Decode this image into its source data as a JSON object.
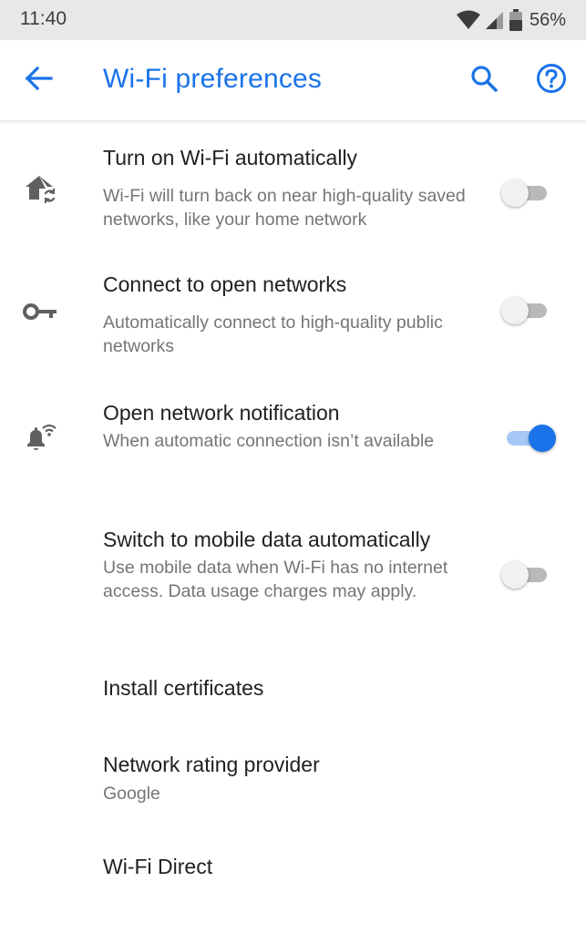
{
  "status_bar": {
    "time": "11:40",
    "battery_percent": "56%",
    "icons": [
      "wifi-signal-icon",
      "cell-signal-icon",
      "battery-icon"
    ]
  },
  "app_bar": {
    "title": "Wi-Fi preferences",
    "icons": [
      "back-arrow-icon",
      "search-icon",
      "help-icon"
    ],
    "accent_color": "#1a73e8"
  },
  "preferences": [
    {
      "title": "Turn on Wi-Fi automatically",
      "summary": "Wi-Fi will turn back on near high-quality saved networks, like your home network",
      "icon": "wifi-home-icon",
      "toggle_on": false
    },
    {
      "title": "Connect to open networks",
      "summary": "Automatically connect to high-quality public networks",
      "icon": "key-icon",
      "toggle_on": false
    },
    {
      "title": "Open network notification",
      "summary": "When automatic connection isn’t available",
      "icon": "wifi-notification-bell-icon",
      "toggle_on": true
    },
    {
      "title": "Switch to mobile data automatically",
      "summary": "Use mobile data when Wi-Fi has no internet access. Data usage charges may apply.",
      "toggle_on": false
    },
    {
      "title": "Install certificates"
    },
    {
      "title": "Network rating provider",
      "summary": "Google"
    },
    {
      "title": "Wi-Fi Direct"
    }
  ]
}
